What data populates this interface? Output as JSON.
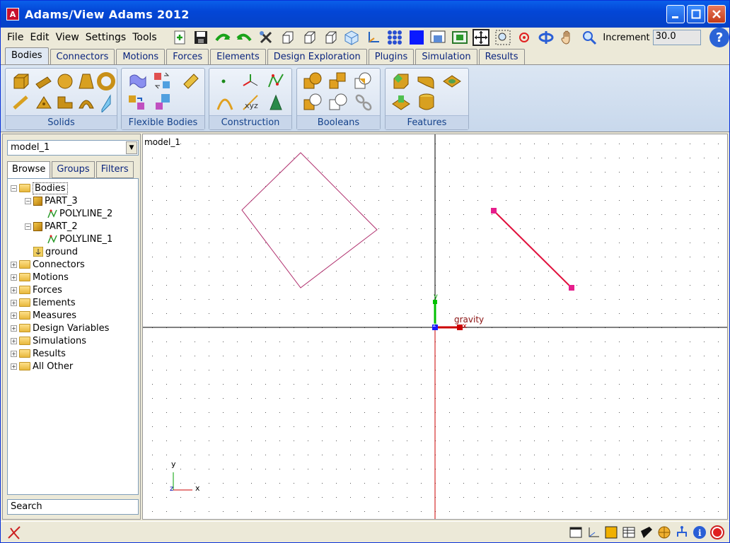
{
  "window": {
    "title": "Adams/View Adams 2012",
    "app_icon": "A"
  },
  "menu": [
    "File",
    "Edit",
    "View",
    "Settings",
    "Tools"
  ],
  "toolbar": {
    "increment_label": "Increment",
    "increment_value": "30.0",
    "help_label": "?"
  },
  "tabs": [
    "Bodies",
    "Connectors",
    "Motions",
    "Forces",
    "Elements",
    "Design Exploration",
    "Plugins",
    "Simulation",
    "Results"
  ],
  "active_tab": "Bodies",
  "ribbon": {
    "groups": [
      "Solids",
      "Flexible Bodies",
      "Construction",
      "Booleans",
      "Features"
    ]
  },
  "browser": {
    "model": "model_1",
    "tabs": [
      "Browse",
      "Groups",
      "Filters"
    ],
    "tree": {
      "bodies": "Bodies",
      "part3": "PART_3",
      "polyline2": "POLYLINE_2",
      "part2": "PART_2",
      "polyline1": "POLYLINE_1",
      "ground": "ground",
      "others": [
        "Connectors",
        "Motions",
        "Forces",
        "Elements",
        "Measures",
        "Design Variables",
        "Simulations",
        "Results",
        "All Other"
      ]
    },
    "search_label": "Search"
  },
  "viewport": {
    "model_label": "model_1",
    "gravity_label": "gravity",
    "axis_x": "x",
    "axis_y": "y",
    "axis_z": "z"
  },
  "colors": {
    "title_bar": "#0346d6",
    "ribbon_label": "#15428b",
    "polyline_square": "#b0306e",
    "polyline_line": "#e0103c",
    "marker": "#e61e8c",
    "gravity": "#cc0000",
    "y_axis": "#00c000"
  }
}
